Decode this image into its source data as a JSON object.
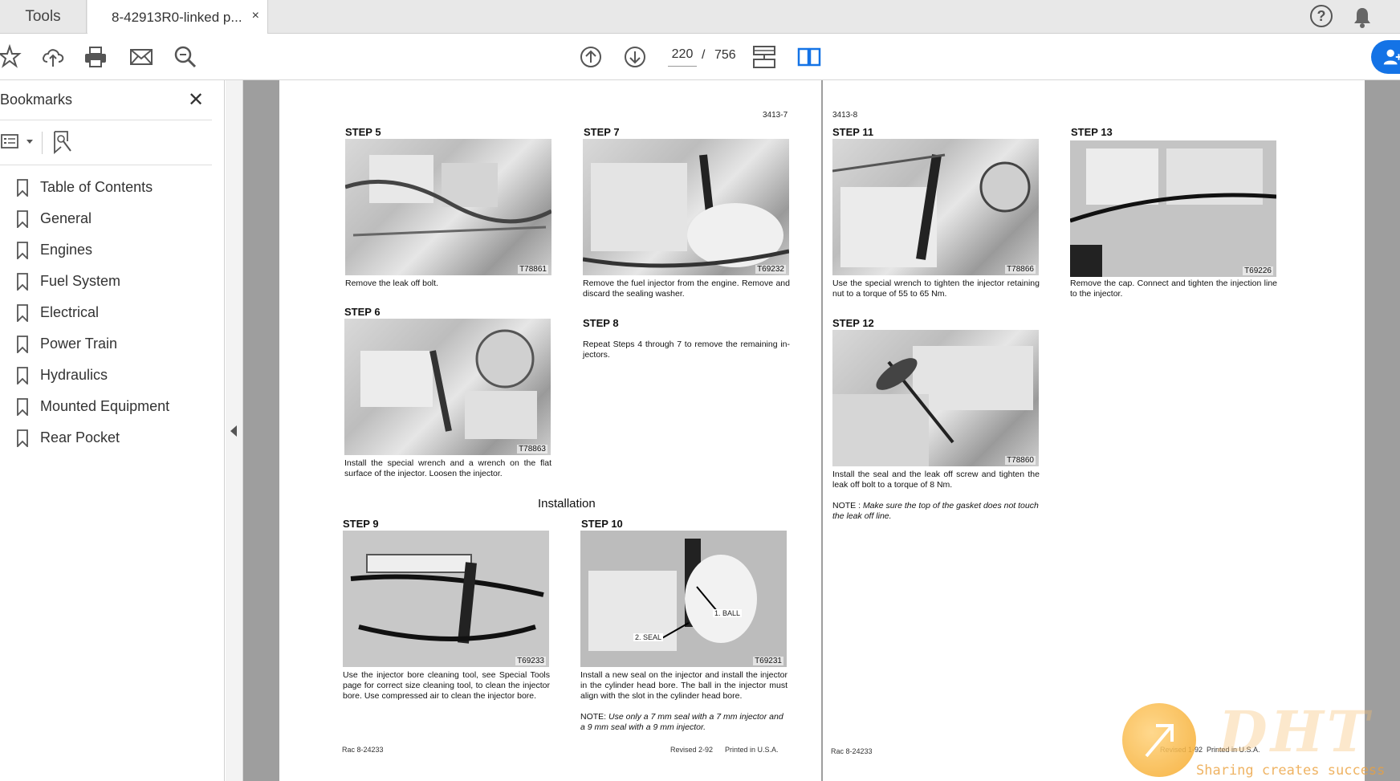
{
  "tabs": {
    "tools_label": "Tools",
    "document_label": "8-42913R0-linked p...",
    "close_glyph": "×"
  },
  "header_icons": [
    "help-icon",
    "bell-icon"
  ],
  "toolbar": {
    "icons": [
      "star-icon",
      "upload-icon",
      "print-icon",
      "mail-icon",
      "zoom-icon",
      "page-up-icon",
      "page-down-icon",
      "scroll-mode-icon",
      "two-page-icon",
      "share-icon"
    ],
    "current_page": "220",
    "separator": "/",
    "total_pages": "756"
  },
  "sidebar": {
    "title": "Bookmarks",
    "close_glyph": "✕",
    "bookmarks": [
      "Table of Contents",
      "General",
      "Engines",
      "Fuel System",
      "Electrical",
      "Power Train",
      "Hydraulics",
      "Mounted Equipment",
      "Rear Pocket"
    ]
  },
  "document": {
    "left_page": {
      "page_number": "3413-7",
      "steps": {
        "s5": {
          "label": "STEP 5",
          "code": "T78861",
          "caption": "Remove the leak off bolt."
        },
        "s6": {
          "label": "STEP 6",
          "code": "T78863",
          "caption": "Install the special wrench and a wrench on the flat surface of the injector. Loosen the injector."
        },
        "s7": {
          "label": "STEP 7",
          "code": "T69232",
          "caption": "Remove the fuel injector from the engine. Remove and discard the sealing washer."
        },
        "s8": {
          "label": "STEP 8",
          "caption": "Repeat Steps 4 through 7 to remove the remaining in-jectors."
        },
        "s9": {
          "label": "STEP 9",
          "code": "T69233",
          "caption": "Use the injector bore cleaning tool, see Special Tools page for correct size cleaning tool, to clean the injector bore. Use compressed air to clean the injector bore."
        },
        "s10": {
          "label": "STEP 10",
          "code": "T69231",
          "caption": "Install a new seal on the injector and install the injector in the cylinder head bore. The ball in the injector must align with the slot in the cylinder head bore.",
          "callout_ball": "1. BALL",
          "callout_seal": "2. SEAL",
          "note_label": "NOTE:",
          "note_text": "Use only a 7 mm seal with a 7 mm injector and a 9 mm seal with a 9 mm injector."
        }
      },
      "section_heading": "Installation",
      "footer_left": "Rac 8-24233",
      "footer_revised": "Revised 2-92",
      "footer_printed": "Printed in U.S.A."
    },
    "right_page": {
      "page_number": "3413-8",
      "steps": {
        "s11": {
          "label": "STEP 11",
          "code": "T78866",
          "caption": "Use the special wrench to tighten the injector retaining nut to a torque of 55 to 65 Nm."
        },
        "s12": {
          "label": "STEP 12",
          "code": "T78860",
          "caption": "Install the seal and the leak off screw and tighten the leak off bolt to a torque of 8 Nm.",
          "note_label": "NOTE :",
          "note_text": "Make sure the top of the gasket does not touch the leak off line."
        },
        "s13": {
          "label": "STEP 13",
          "code": "T69226",
          "caption": "Remove the cap. Connect and tighten the injection line to the injector."
        }
      },
      "footer_left": "Rac 8-24233",
      "footer_revised": "Revised 1-92",
      "footer_printed": "Printed in U.S.A."
    }
  },
  "watermark": {
    "logo": "DHT",
    "slogan": "Sharing creates success"
  }
}
